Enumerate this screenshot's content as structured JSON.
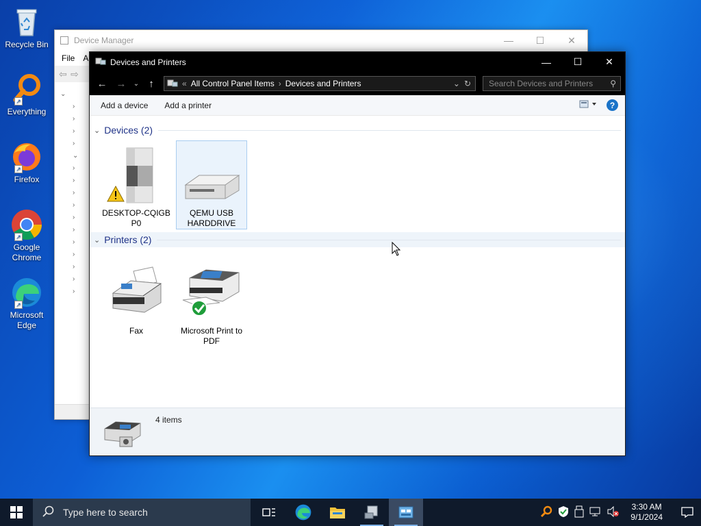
{
  "desktop": {
    "icons": [
      {
        "label": "Recycle Bin"
      },
      {
        "label": "Everything"
      },
      {
        "label": "Firefox"
      },
      {
        "label": "Google Chrome"
      },
      {
        "label": "Microsoft Edge"
      }
    ]
  },
  "device_manager": {
    "title": "Device Manager",
    "menu": [
      "File",
      "A"
    ]
  },
  "window": {
    "title": "Devices and Printers",
    "controls": {
      "minimize": "—",
      "maximize": "☐",
      "close": "✕"
    },
    "address": {
      "overflow": "«",
      "crumbs": [
        "All Control Panel Items",
        "Devices and Printers"
      ]
    },
    "search": {
      "placeholder": "Search Devices and Printers"
    },
    "commands": {
      "add_device": "Add a device",
      "add_printer": "Add a printer",
      "help": "?"
    },
    "groups": {
      "devices": {
        "label": "Devices (2)"
      },
      "printers": {
        "label": "Printers (2)"
      }
    },
    "devices": [
      {
        "label": "DESKTOP-CQIGB P0",
        "icon": "computer-tower-warning"
      },
      {
        "label": "QEMU USB HARDDRIVE",
        "icon": "usb-harddrive"
      }
    ],
    "printers": [
      {
        "label": "Fax",
        "icon": "fax-machine"
      },
      {
        "label": "Microsoft Print to PDF",
        "icon": "printer-default"
      }
    ],
    "details": {
      "count": "4 items"
    }
  },
  "taskbar": {
    "search_placeholder": "Type here to search",
    "time": "3:30 AM",
    "date": "9/1/2024"
  },
  "colors": {
    "accent": "#1e3287",
    "selection": "#eaf3fc",
    "taskbar": "#0f1a2b"
  }
}
